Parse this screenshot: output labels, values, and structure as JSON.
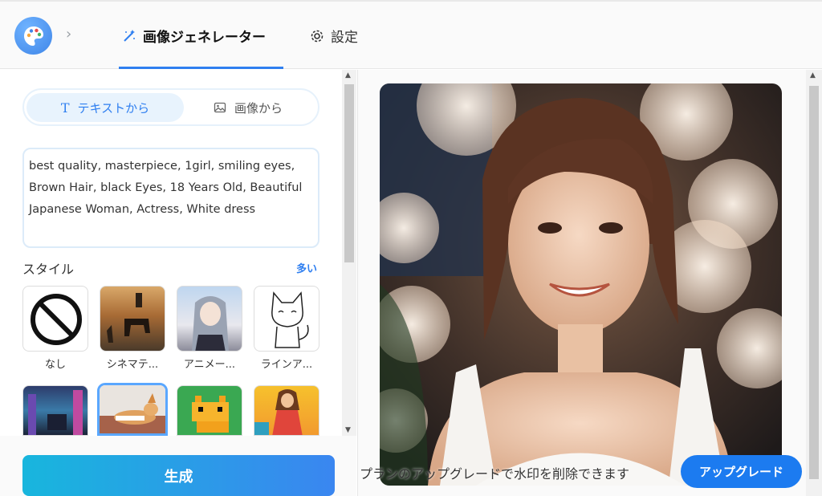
{
  "header": {
    "tabs": [
      {
        "label": "画像ジェネレーター",
        "active": true
      },
      {
        "label": "設定",
        "active": false
      }
    ]
  },
  "mode_toggle": {
    "text_option": "テキストから",
    "image_option": "画像から"
  },
  "prompt": {
    "value": "best quality, masterpiece, 1girl, smiling eyes, Brown Hair, black Eyes, 18 Years Old, Beautiful Japanese Woman, Actress, White dress"
  },
  "styles": {
    "label": "スタイル",
    "more_label": "多い",
    "items": [
      {
        "label": "なし"
      },
      {
        "label": "シネマテ..."
      },
      {
        "label": "アニメー..."
      },
      {
        "label": "ラインア..."
      },
      {
        "label": ""
      },
      {
        "label": "",
        "selected": true
      },
      {
        "label": ""
      },
      {
        "label": ""
      }
    ]
  },
  "generate_label": "生成",
  "result": {
    "watermark_notice": "プランのアップグレードで水印を削除できます",
    "upgrade_label": "アップグレード"
  },
  "colors": {
    "accent": "#2f7ff0",
    "upgrade": "#1c7bf0"
  }
}
